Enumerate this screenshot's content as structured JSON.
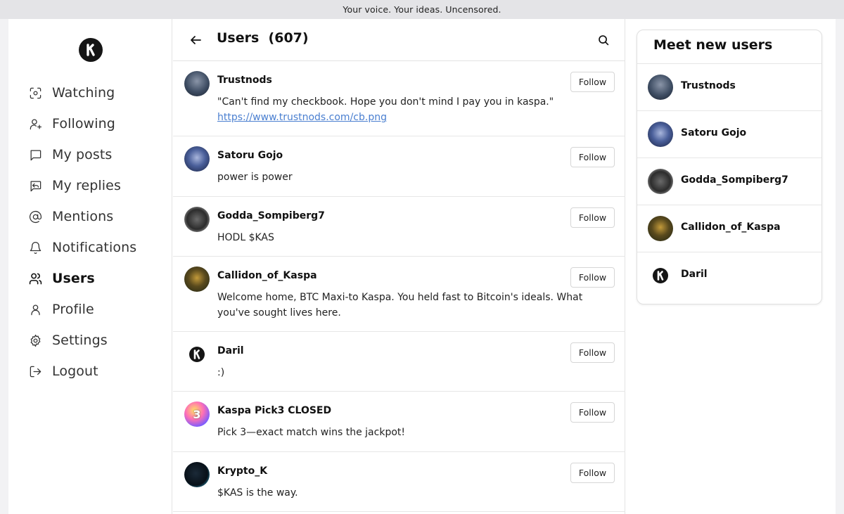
{
  "banner": {
    "text": "Your voice. Your ideas. Uncensored."
  },
  "sidebar": {
    "items": [
      {
        "label": "Watching",
        "icon": "eye-scan-icon"
      },
      {
        "label": "Following",
        "icon": "user-plus-icon"
      },
      {
        "label": "My posts",
        "icon": "message-square-icon"
      },
      {
        "label": "My replies",
        "icon": "reply-message-icon"
      },
      {
        "label": "Mentions",
        "icon": "at-sign-icon"
      },
      {
        "label": "Notifications",
        "icon": "bell-icon"
      },
      {
        "label": "Users",
        "icon": "users-icon",
        "active": true
      },
      {
        "label": "Profile",
        "icon": "user-icon"
      },
      {
        "label": "Settings",
        "icon": "gear-icon"
      },
      {
        "label": "Logout",
        "icon": "logout-icon"
      }
    ]
  },
  "main": {
    "title": "Users",
    "count": "(607)",
    "follow_label": "Follow",
    "users": [
      {
        "name": "Trustnods",
        "text": "\"Can't find my checkbook. Hope you don't mind I pay you in kaspa.\" ",
        "link": "https://www.trustnods.com/cb.png",
        "avatar": "trustnods-avatar"
      },
      {
        "name": "Satoru Gojo",
        "text": "power is power",
        "avatar": "satoru-gojo-avatar"
      },
      {
        "name": "Godda_Sompiberg7",
        "text": "HODL $KAS",
        "avatar": "godda-avatar"
      },
      {
        "name": "Callidon_of_Kaspa",
        "text": "Welcome home, BTC Maxi-to Kaspa. You held fast to Bitcoin's ideals. What you've sought lives here.",
        "avatar": "callidon-avatar"
      },
      {
        "name": "Daril",
        "text": ":)",
        "avatar": "kaspa-logo-avatar"
      },
      {
        "name": "Kaspa Pick3 CLOSED",
        "text": "Pick 3—exact match wins the jackpot!",
        "avatar": "pick3-ball-avatar"
      },
      {
        "name": "Krypto_K",
        "text": "$KAS is the way.",
        "avatar": "krypto-k-avatar"
      }
    ]
  },
  "right": {
    "title": "Meet new users",
    "users": [
      {
        "name": "Trustnods"
      },
      {
        "name": "Satoru Gojo"
      },
      {
        "name": "Godda_Sompiberg7"
      },
      {
        "name": "Callidon_of_Kaspa"
      },
      {
        "name": "Daril"
      }
    ]
  },
  "colors": {
    "link": "#4a7fd0",
    "banner_bg": "#e4e4e7",
    "logo": "#151515"
  }
}
